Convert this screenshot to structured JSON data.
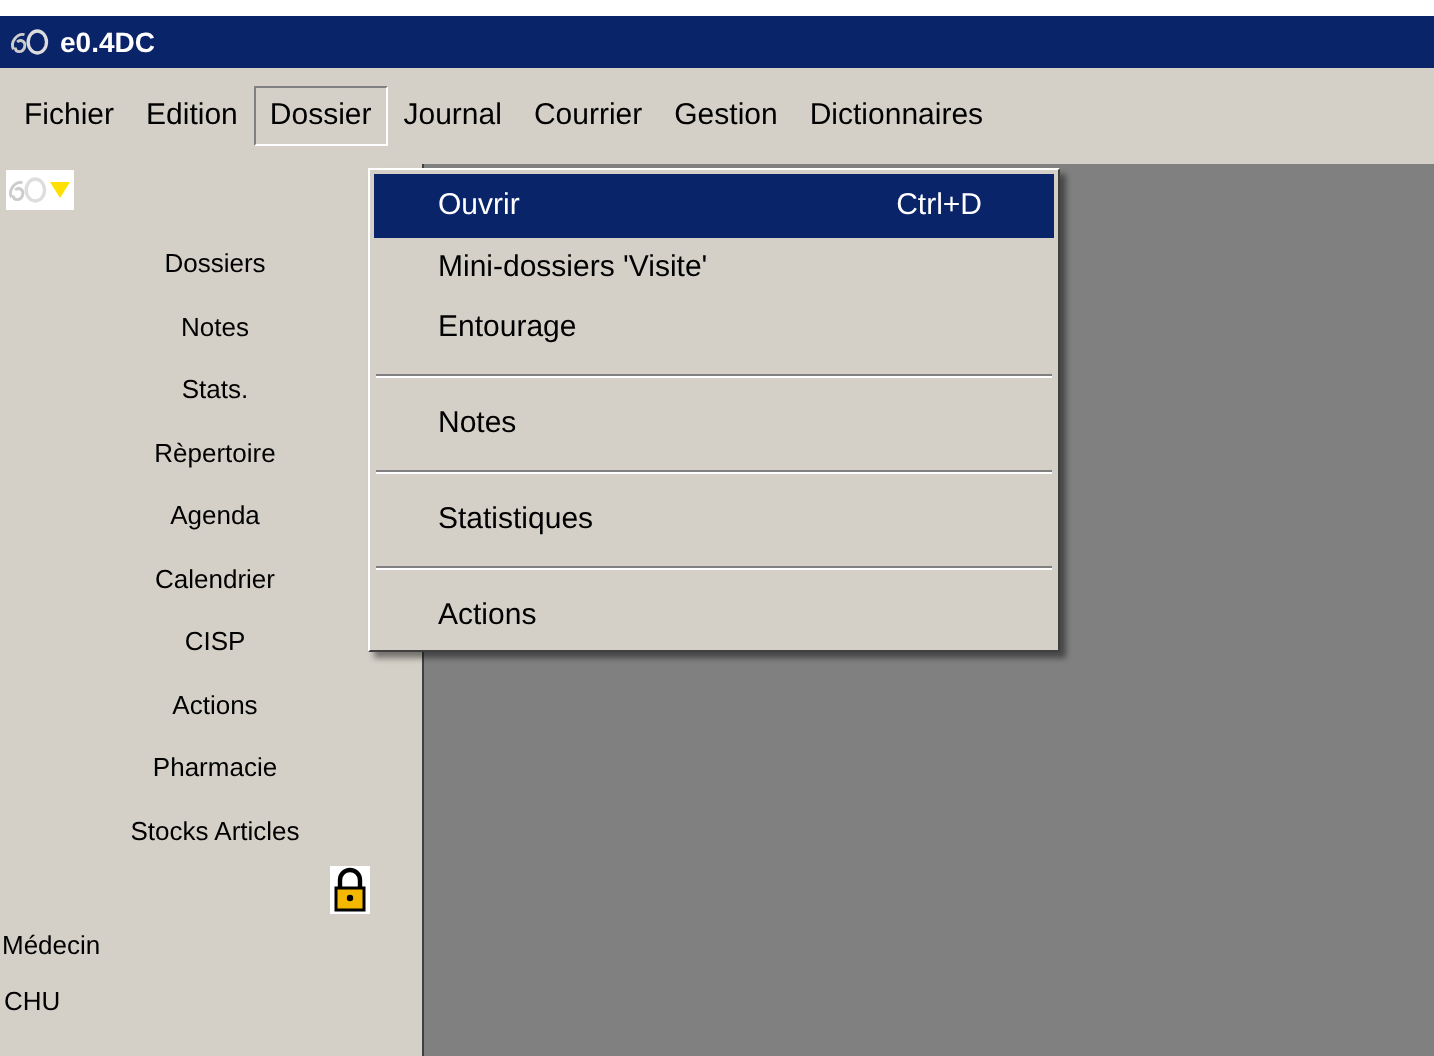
{
  "window": {
    "title": "e0.4DC"
  },
  "menubar": [
    {
      "label": "Fichier",
      "selected": false
    },
    {
      "label": "Edition",
      "selected": false
    },
    {
      "label": "Dossier",
      "selected": true
    },
    {
      "label": "Journal",
      "selected": false
    },
    {
      "label": "Courrier",
      "selected": false
    },
    {
      "label": "Gestion",
      "selected": false
    },
    {
      "label": "Dictionnaires",
      "selected": false
    }
  ],
  "dropdown": [
    {
      "kind": "item",
      "label": "Ouvrir",
      "shortcut": "Ctrl+D",
      "selected": true
    },
    {
      "kind": "item",
      "label": "Mini-dossiers 'Visite'",
      "selected": false
    },
    {
      "kind": "item",
      "label": "Entourage",
      "selected": false
    },
    {
      "kind": "separator"
    },
    {
      "kind": "item",
      "label": "Notes",
      "selected": false
    },
    {
      "kind": "separator"
    },
    {
      "kind": "item",
      "label": "Statistiques",
      "selected": false
    },
    {
      "kind": "separator"
    },
    {
      "kind": "item",
      "label": "Actions",
      "selected": false
    }
  ],
  "sidebar": {
    "items": [
      "Dossiers",
      "Notes",
      "Stats.",
      "Rèpertoire",
      "Agenda",
      "Calendrier",
      "CISP",
      "Actions",
      "Pharmacie",
      "Stocks Articles"
    ],
    "user": "Médecin",
    "site": "CHU"
  }
}
